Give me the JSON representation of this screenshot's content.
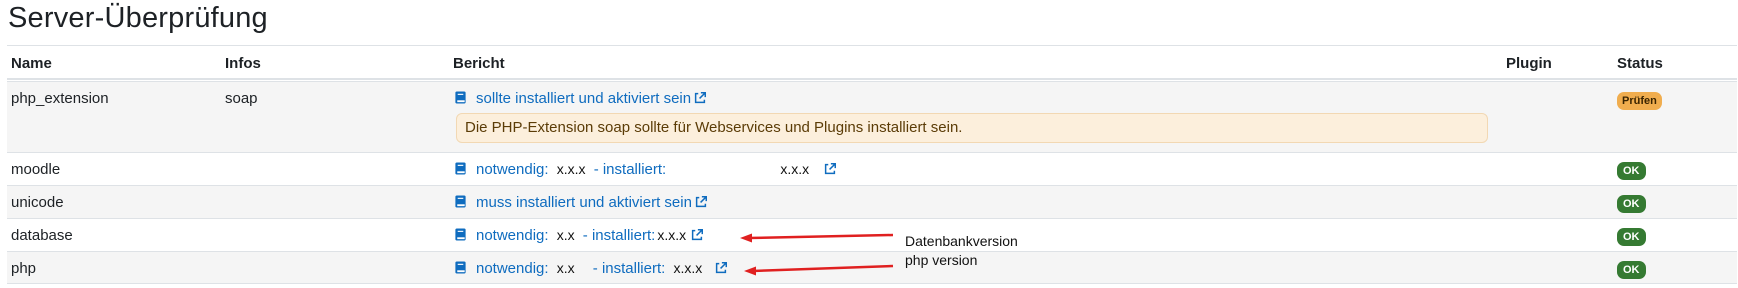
{
  "page": {
    "title": "Server-Überprüfung"
  },
  "table": {
    "headers": {
      "name": "Name",
      "infos": "Infos",
      "bericht": "Bericht",
      "plugin": "Plugin",
      "status": "Status"
    },
    "rows": [
      {
        "name": "php_extension",
        "infos": "soap",
        "report_link": "sollte installiert und aktiviert sein",
        "alert": "Die PHP-Extension soap sollte für Webservices und Plugins installiert sein.",
        "status": "Prüfen",
        "status_type": "warning"
      },
      {
        "name": "moodle",
        "infos": "",
        "report_required_label": "notwendig:",
        "report_required_value": "x.x.x",
        "report_installed_label": "- installiert:",
        "report_installed_value": "x.x.x",
        "status": "OK",
        "status_type": "success"
      },
      {
        "name": "unicode",
        "infos": "",
        "report_link": "muss installiert und aktiviert sein",
        "status": "OK",
        "status_type": "success"
      },
      {
        "name": "database",
        "infos": "",
        "report_required_label": "notwendig:",
        "report_required_value": "x.x",
        "report_installed_label": "- installiert:",
        "report_installed_value": "x.x.x",
        "status": "OK",
        "status_type": "success"
      },
      {
        "name": "php",
        "infos": "",
        "report_required_label": "notwendig:",
        "report_required_value": "x.x",
        "report_installed_label": "- installiert:",
        "report_installed_value": "x.x.x",
        "status": "OK",
        "status_type": "success"
      }
    ]
  },
  "annotations": {
    "database_note": "Datenbankversion",
    "php_note": "php version",
    "arrow_color": "#e02020"
  },
  "colors": {
    "link": "#0f6cbf",
    "ok_badge": "#357a32",
    "warn_badge": "#f0ad4e",
    "alert_bg": "#fcefdc"
  },
  "icons": {
    "docs": "book-icon",
    "external": "external-link-icon"
  }
}
